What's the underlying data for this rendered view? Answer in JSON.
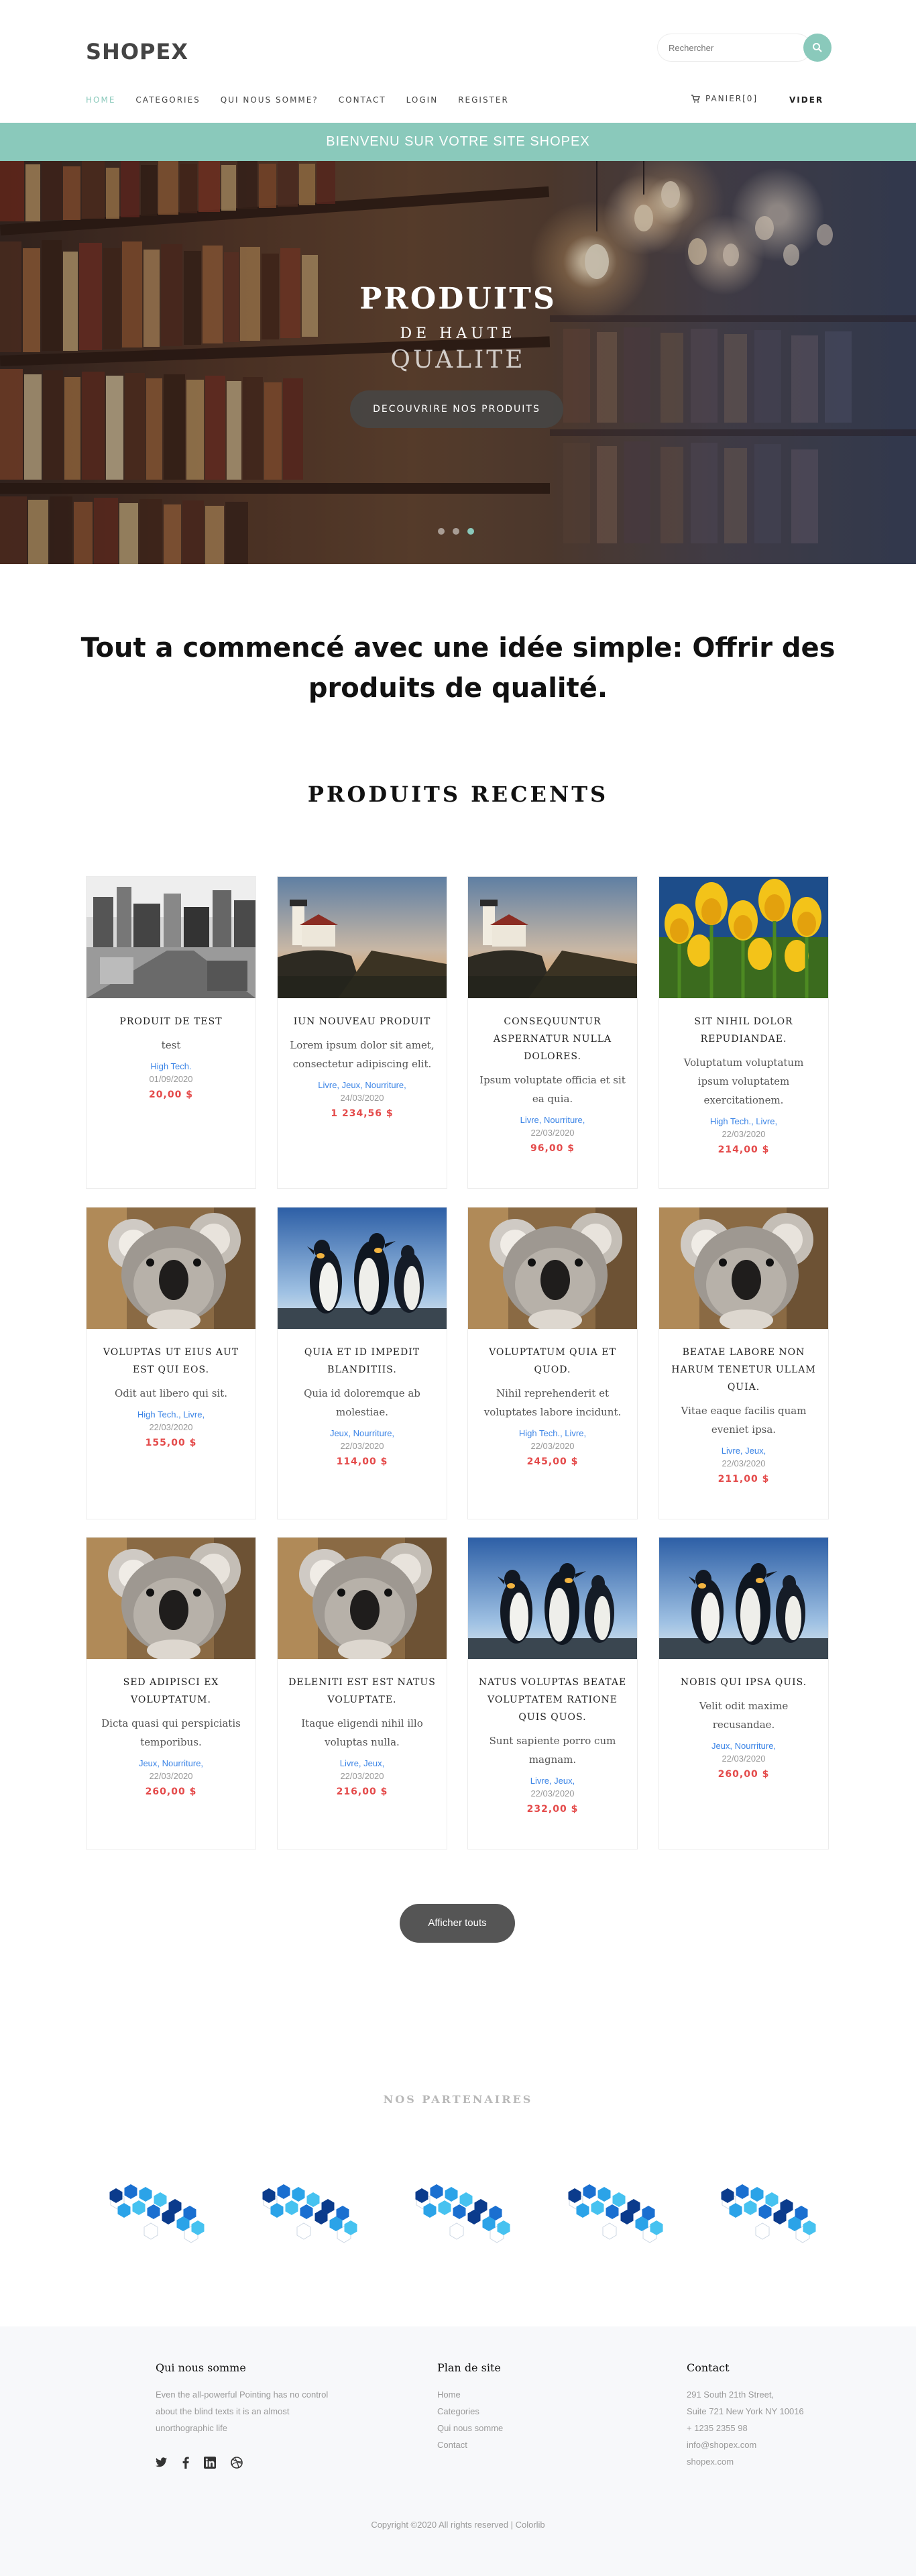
{
  "header": {
    "logo": "SHOPEX",
    "search_placeholder": "Rechercher",
    "nav": [
      "HOME",
      "CATEGORIES",
      "QUI NOUS SOMME?",
      "CONTACT",
      "LOGIN",
      "REGISTER"
    ],
    "cart_label": "PANIER[0]",
    "vider_label": "VIDER"
  },
  "banner": {
    "text": "BIENVENU SUR VOTRE SITE SHOPEX"
  },
  "hero": {
    "title": "PRODUITS",
    "subtitle1": "DE HAUTE",
    "subtitle2": "QUALITE",
    "button": "DECOUVRIRE NOS PRODUITS",
    "slides": 3,
    "active_slide": 3
  },
  "intro": "Tout a commencé avec une idée simple: Offrir des produits de qualité.",
  "products_title": "PRODUITS RECENTS",
  "products": [
    {
      "title": "PRODUIT DE TEST",
      "desc": "test",
      "cat": "High Tech.",
      "date": "01/09/2020",
      "price": "20,00 $",
      "image": "city"
    },
    {
      "title": "IUN NOUVEAU PRODUIT",
      "desc": "Lorem ipsum dolor sit amet, consectetur adipiscing elit.",
      "cat": "Livre, Jeux, Nourriture,",
      "date": "24/03/2020",
      "price": "1 234,56 $",
      "image": "lighthouse"
    },
    {
      "title": "CONSEQUUNTUR ASPERNATUR NULLA DOLORES.",
      "desc": "Ipsum voluptate officia et sit ea quia.",
      "cat": "Livre, Nourriture,",
      "date": "22/03/2020",
      "price": "96,00 $",
      "image": "lighthouse"
    },
    {
      "title": "SIT NIHIL DOLOR REPUDIANDAE.",
      "desc": "Voluptatum voluptatum ipsum voluptatem exercitationem.",
      "cat": "High Tech., Livre,",
      "date": "22/03/2020",
      "price": "214,00 $",
      "image": "tulips"
    },
    {
      "title": "VOLUPTAS UT EIUS AUT EST QUI EOS.",
      "desc": "Odit aut libero qui sit.",
      "cat": "High Tech., Livre,",
      "date": "22/03/2020",
      "price": "155,00 $",
      "image": "koala"
    },
    {
      "title": "QUIA ET ID IMPEDIT BLANDITIIS.",
      "desc": "Quia id doloremque ab molestiae.",
      "cat": "Jeux, Nourriture,",
      "date": "22/03/2020",
      "price": "114,00 $",
      "image": "penguins"
    },
    {
      "title": "VOLUPTATUM QUIA ET QUOD.",
      "desc": "Nihil reprehenderit et voluptates labore incidunt.",
      "cat": "High Tech., Livre,",
      "date": "22/03/2020",
      "price": "245,00 $",
      "image": "koala"
    },
    {
      "title": "BEATAE LABORE NON HARUM TENETUR ULLAM QUIA.",
      "desc": "Vitae eaque facilis quam eveniet ipsa.",
      "cat": "Livre, Jeux,",
      "date": "22/03/2020",
      "price": "211,00 $",
      "image": "koala"
    },
    {
      "title": "SED ADIPISCI EX VOLUPTATUM.",
      "desc": "Dicta quasi qui perspiciatis temporibus.",
      "cat": "Jeux, Nourriture,",
      "date": "22/03/2020",
      "price": "260,00 $",
      "image": "koala"
    },
    {
      "title": "DELENITI EST EST NATUS VOLUPTATE.",
      "desc": "Itaque eligendi nihil illo voluptas nulla.",
      "cat": "Livre, Jeux,",
      "date": "22/03/2020",
      "price": "216,00 $",
      "image": "koala"
    },
    {
      "title": "NATUS VOLUPTAS BEATAE VOLUPTATEM RATIONE QUIS QUOS.",
      "desc": "Sunt sapiente porro cum magnam.",
      "cat": "Livre, Jeux,",
      "date": "22/03/2020",
      "price": "232,00 $",
      "image": "penguins"
    },
    {
      "title": "NOBIS QUI IPSA QUIS.",
      "desc": "Velit odit maxime recusandae.",
      "cat": "Jeux, Nourriture,",
      "date": "22/03/2020",
      "price": "260,00 $",
      "image": "penguins"
    }
  ],
  "more_button": "Afficher touts",
  "partners_title": "NOS PARTENAIRES",
  "partners_count": 5,
  "footer": {
    "about": {
      "heading": "Qui nous somme",
      "text": [
        "Even the all-powerful Pointing has no control",
        "about the blind texts it is an almost",
        "unorthographic life"
      ]
    },
    "sitemap": {
      "heading": "Plan de site",
      "links": [
        "Home",
        "Categories",
        "Qui nous somme",
        "Contact"
      ]
    },
    "contact": {
      "heading": "Contact",
      "lines": [
        "291 South 21th Street,",
        "Suite 721 New York NY 10016",
        "+ 1235 2355 98",
        "info@shopex.com",
        "shopex.com"
      ]
    },
    "social": [
      "twitter-icon",
      "facebook-icon",
      "linkedin-icon",
      "dribbble-icon"
    ],
    "copyright": "Copyright ©2020 All rights reserved | Colorlib"
  },
  "colors": {
    "accent": "#8ac9bb",
    "price": "#e44a4a",
    "category": "#3b84e6",
    "button": "#555555"
  }
}
